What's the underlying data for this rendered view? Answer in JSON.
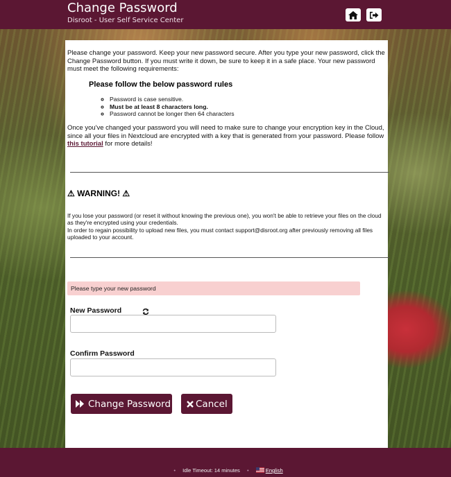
{
  "header": {
    "title": "Change Password",
    "subtitle": "Disroot - User Self Service Center",
    "home_icon": "home-icon",
    "logout_icon": "sign-out-icon"
  },
  "intro": {
    "text": "Please change your password. Keep your new password secure. After you type your new password, click the Change Password button. If you must write it down, be sure to keep it in a safe place. Your new password must meet the following requirements:",
    "rules_heading": "Please follow the below password rules",
    "rules": [
      "Password is case sensitive.",
      "Must be at least 8 characters long.",
      "Password cannot be longer then 64 characters"
    ]
  },
  "nextcloud": {
    "text_before": "Once you've changed your password you will need to make sure to change your encryption key in the Cloud, since all your files in Nextcloud are encrypted with a key that is generated from your password. Please follow ",
    "link": "this tutorial",
    "text_after": " for more details!"
  },
  "warning": {
    "title": "⚠ WARNING! ⚠",
    "line1": "If you lose your password (or reset it without knowing the previous one), you won't be able to retrieve your files on the cloud as they're encrypted using your credentials.",
    "line2": "In order to regain possibility to upload new files, you must contact support@disroot.org after previously removing all files uploaded to your account."
  },
  "form": {
    "alert": "Please type your new password",
    "new_password_label": "New Password",
    "new_password_value": "",
    "confirm_password_label": "Confirm Password",
    "confirm_password_value": "",
    "change_button": "Change Password",
    "cancel_button": "Cancel"
  },
  "footer": {
    "idle_timeout": "Idle Timeout: 14 minutes",
    "language": "English"
  },
  "colors": {
    "brand": "#5b1733",
    "alert_bg": "#f8d0d0"
  }
}
